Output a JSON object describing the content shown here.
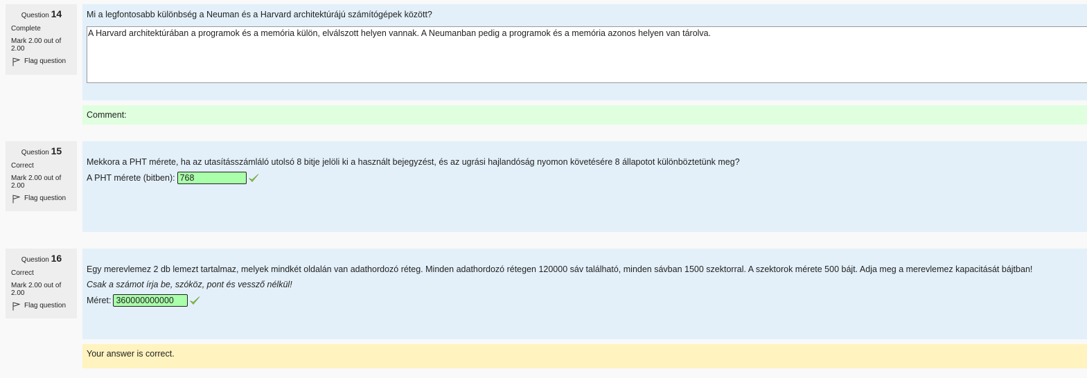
{
  "questions": [
    {
      "label": "Question",
      "number": "14",
      "state": "Complete",
      "mark": "Mark 2.00 out of 2.00",
      "flag_label": "Flag question",
      "text": "Mi a legfontosabb különbség a Neuman és a Harvard architektúrájú számítógépek között?",
      "answer": "A Harvard architektúrában a programok és a memória külön, elválszott helyen vannak. A Neumanban pedig a programok és a memória azonos helyen van tárolva.",
      "comment_label": "Comment:"
    },
    {
      "label": "Question",
      "number": "15",
      "state": "Correct",
      "mark": "Mark 2.00 out of 2.00",
      "flag_label": "Flag question",
      "text": "Mekkora a PHT mérete, ha az utasításszámláló utolsó 8 bitje jelöli ki a használt bejegyzést, és az ugrási hajlandóság nyomon követésére 8 állapotot különböztetünk meg?",
      "answer_label": "A PHT mérete (bitben):",
      "answer": "768"
    },
    {
      "label": "Question",
      "number": "16",
      "state": "Correct",
      "mark": "Mark 2.00 out of 2.00",
      "flag_label": "Flag question",
      "text": "Egy merevlemez 2 db lemezt tartalmaz, melyek mindkét oldalán van adathordozó réteg. Minden adathordozó rétegen 120000 sáv található, minden sávban 1500 szektorral. A szektorok mérete 500 bájt. Adja meg a merevlemez kapacitását bájtban!",
      "hint": "Csak a számot írja be, szóköz, pont és vessző nélkül!",
      "answer_label": "Méret:",
      "answer": "360000000000",
      "feedback": "Your answer is correct."
    }
  ],
  "colors": {
    "formulation_bg": "#e3f0f9",
    "comment_bg": "#dfffdf",
    "feedback_bg": "#fff3bf",
    "correct_input_bg": "#aaffaa",
    "tick": "#8bc34a"
  },
  "icons": {
    "flag": "flag-outline-icon",
    "correct": "checkmark-icon"
  }
}
